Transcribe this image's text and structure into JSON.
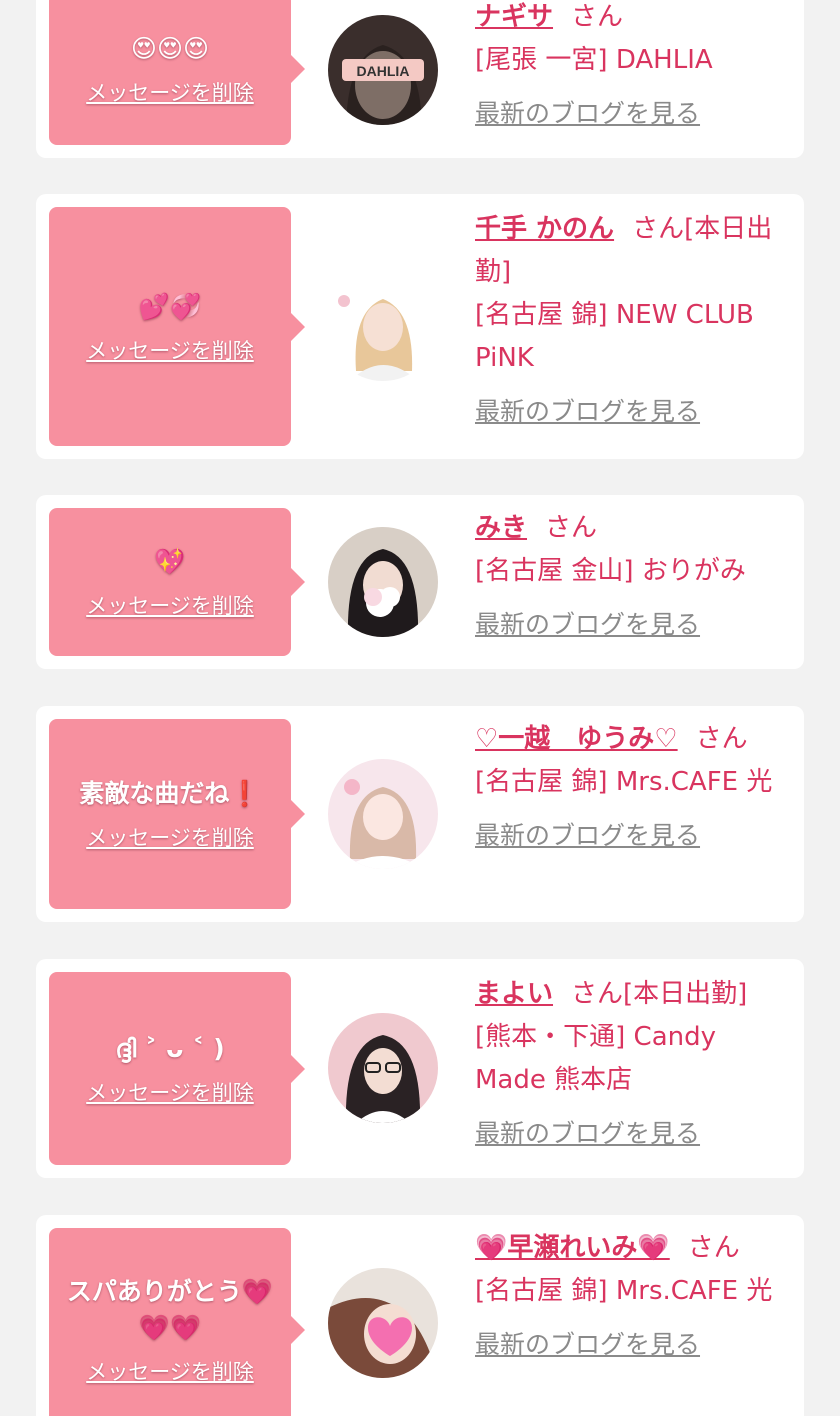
{
  "cards": [
    {
      "message": "😍😍😍",
      "delete_label": "メッセージを削除",
      "name": "ナギサ",
      "honorific": "さん",
      "status": "",
      "shop": "[尾張 一宮] DAHLIA",
      "blog_link": "最新のブログを見る",
      "avatar_text": "DAHLIA"
    },
    {
      "message": "💕💞",
      "delete_label": "メッセージを削除",
      "name": "千手 かのん",
      "honorific": "さん",
      "status": "[本日出勤]",
      "shop": "[名古屋 錦] NEW CLUB PiNK",
      "blog_link": "最新のブログを見る"
    },
    {
      "message": "💖",
      "delete_label": "メッセージを削除",
      "name": "みき",
      "honorific": "さん",
      "status": "",
      "shop": "[名古屋 金山] おりがみ",
      "blog_link": "最新のブログを見る"
    },
    {
      "message": "素敵な曲だね❗️",
      "delete_label": "メッセージを削除",
      "name": "♡一越　ゆうみ♡",
      "honorific": "さん",
      "status": "",
      "shop": "[名古屋 錦] Mrs.CAFE 光",
      "blog_link": "最新のブログを見る"
    },
    {
      "message": "ദ്ദി ˃ ᴗ ˂ )",
      "delete_label": "メッセージを削除",
      "name": "まよい",
      "honorific": "さん",
      "status": "[本日出勤]",
      "shop": "[熊本・下通] Candy Made 熊本店",
      "blog_link": "最新のブログを見る"
    },
    {
      "message": "スパありがとう💗💗💗",
      "delete_label": "メッセージを削除",
      "name": "💗早瀬れいみ💗",
      "honorific": "さん",
      "status": "",
      "shop": "[名古屋 錦] Mrs.CAFE 光",
      "blog_link": "最新のブログを見る"
    }
  ]
}
